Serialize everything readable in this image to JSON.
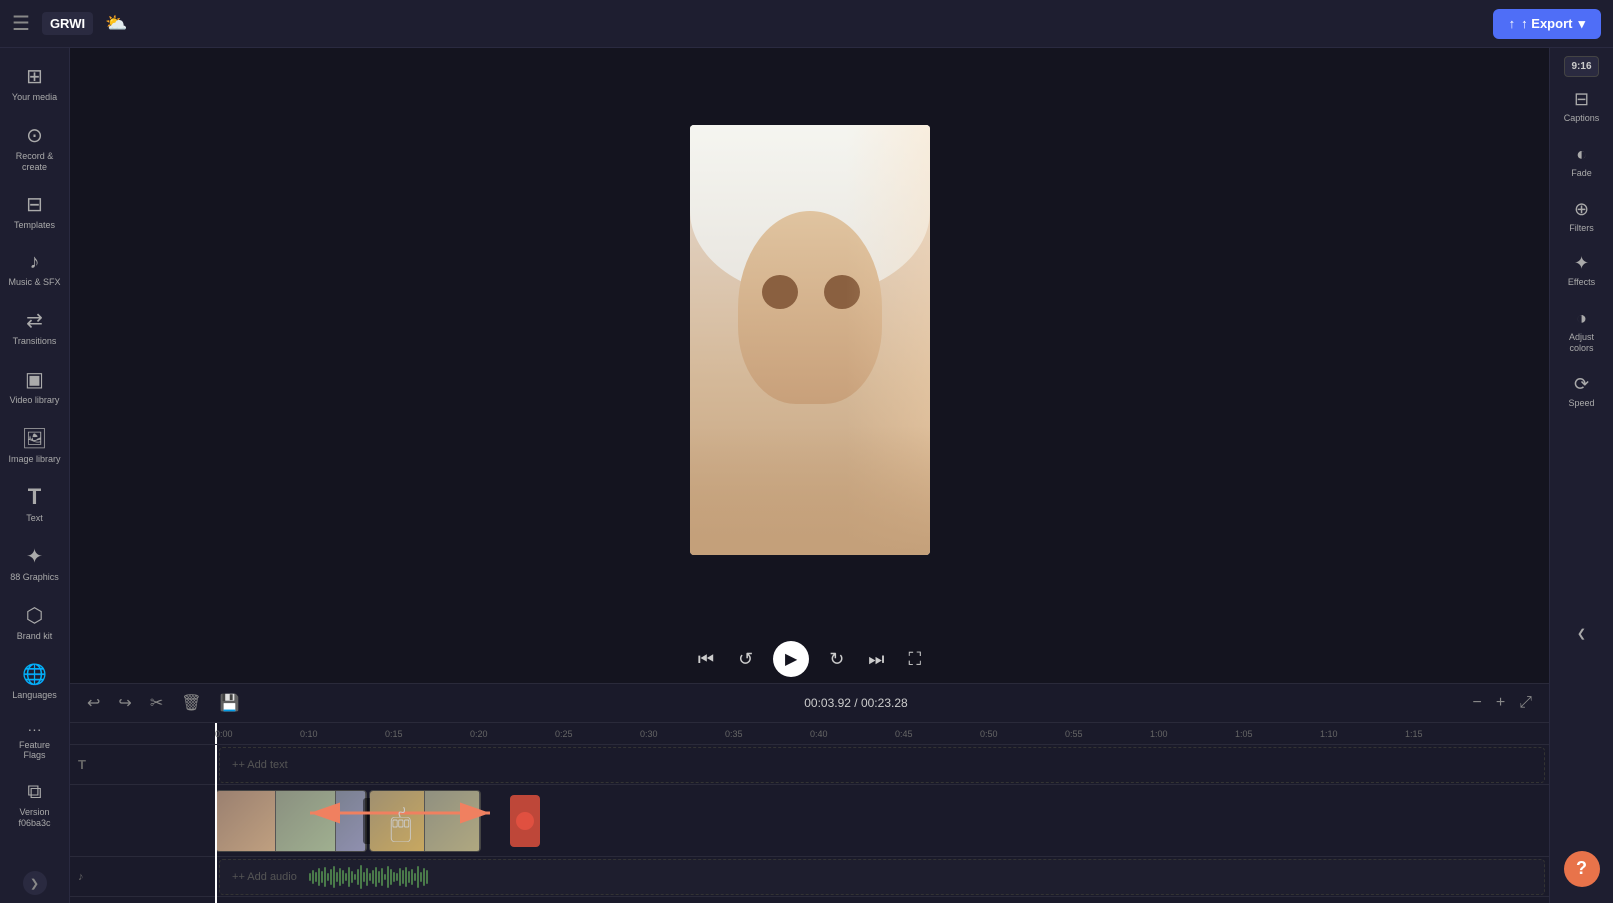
{
  "app": {
    "title": "GRWI",
    "hamburger_icon": "☰",
    "cloud_icon": "☁",
    "export_label": "↑ Export",
    "export_dropdown": "▾"
  },
  "left_sidebar": {
    "items": [
      {
        "id": "your-media",
        "icon": "⊞",
        "label": "Your media"
      },
      {
        "id": "record",
        "icon": "⊙",
        "label": "Record &\ncreate"
      },
      {
        "id": "templates",
        "icon": "⊟",
        "label": "Templates"
      },
      {
        "id": "music-sfx",
        "icon": "♪",
        "label": "Music & SFX"
      },
      {
        "id": "transitions",
        "icon": "⇄",
        "label": "Transitions"
      },
      {
        "id": "video-library",
        "icon": "▣",
        "label": "Video library"
      },
      {
        "id": "image-library",
        "icon": "🖼",
        "label": "Image library"
      },
      {
        "id": "text",
        "icon": "T",
        "label": "Text"
      },
      {
        "id": "graphics",
        "icon": "✦",
        "label": "88 Graphics"
      },
      {
        "id": "brand-kit",
        "icon": "⬡",
        "label": "Brand kit"
      },
      {
        "id": "languages",
        "icon": "🌐",
        "label": "Languages"
      },
      {
        "id": "feature-flags",
        "icon": "···",
        "label": "Feature Flags"
      },
      {
        "id": "version",
        "icon": "⧉",
        "label": "Version\nf06ba3c"
      }
    ],
    "collapse_icon": "❯"
  },
  "preview": {
    "time_current": "00:03.92",
    "time_total": "00:23.28",
    "time_display": "00:03.92 / 00:23.28"
  },
  "player_controls": {
    "skip_back_icon": "⏮",
    "rewind_icon": "↺",
    "play_icon": "▶",
    "forward_icon": "↻",
    "skip_forward_icon": "⏭",
    "fullscreen_icon": "⛶"
  },
  "timeline": {
    "undo_icon": "↩",
    "redo_icon": "↪",
    "cut_icon": "✂",
    "delete_icon": "🗑",
    "save_icon": "💾",
    "zoom_out_icon": "−",
    "zoom_in_icon": "+",
    "expand_icon": "⤢",
    "ruler_marks": [
      "0:00",
      "0:10",
      "0:15",
      "0:20",
      "0:25",
      "0:30",
      "0:35",
      "0:40",
      "0:45",
      "0:50",
      "0:55",
      "1:00",
      "1:05",
      "1:10",
      "1:15"
    ],
    "add_text_label": "+ Add text",
    "add_audio_label": "+ Add audio",
    "text_icon": "T",
    "audio_icon": "♪"
  },
  "right_sidebar": {
    "aspect_ratio": "9:16",
    "items": [
      {
        "id": "captions",
        "icon": "⊟",
        "label": "Captions"
      },
      {
        "id": "fade",
        "icon": "◐",
        "label": "Fade"
      },
      {
        "id": "filters",
        "icon": "⊕",
        "label": "Filters"
      },
      {
        "id": "effects",
        "icon": "✦",
        "label": "Effects"
      },
      {
        "id": "adjust-colors",
        "icon": "◑",
        "label": "Adjust colors"
      },
      {
        "id": "speed",
        "icon": "⟳",
        "label": "Speed"
      }
    ],
    "collapse_icon": "❮",
    "help_label": "?"
  }
}
